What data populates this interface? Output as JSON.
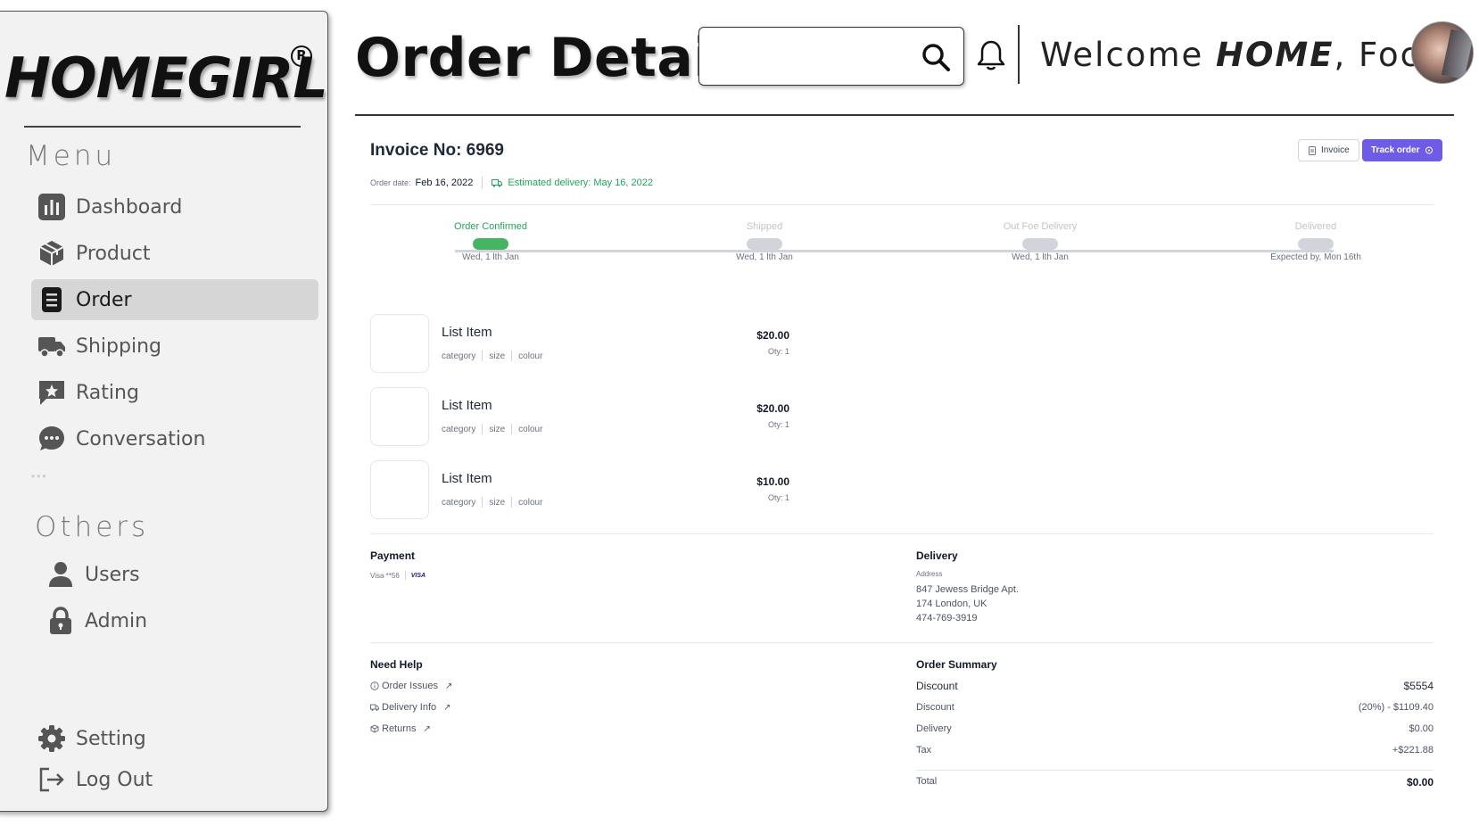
{
  "brand": {
    "logo": "HOMEGIRL",
    "reg_mark": "R"
  },
  "sidebar": {
    "menu_title": "Menu",
    "menu_items": [
      {
        "label": "Dashboard",
        "icon": "bar-chart-icon"
      },
      {
        "label": "Product",
        "icon": "box-icon"
      },
      {
        "label": "Order",
        "icon": "document-icon",
        "active": true
      },
      {
        "label": "Shipping",
        "icon": "truck-icon"
      },
      {
        "label": "Rating",
        "icon": "star-bubble-icon"
      },
      {
        "label": "Conversation",
        "icon": "chat-bubble-icon"
      }
    ],
    "others_title": "Others",
    "others_items": [
      {
        "label": "Users",
        "icon": "user-icon"
      },
      {
        "label": "Admin",
        "icon": "lock-icon"
      }
    ],
    "bottom_items": [
      {
        "label": "Setting",
        "icon": "gear-icon"
      },
      {
        "label": "Log Out",
        "icon": "logout-icon"
      }
    ]
  },
  "header": {
    "title": "Order Detail",
    "search": {
      "value": "",
      "placeholder": ""
    },
    "welcome_prefix": "Welcome ",
    "welcome_bold": "HOME",
    "welcome_suffix": ", Focus"
  },
  "order": {
    "invoice_title": "Invoice No: 6969",
    "invoice_button": "Invoice",
    "track_button": "Track order",
    "order_date_label": "Order date:",
    "order_date": "Feb 16, 2022",
    "estimated_delivery": "Estimated delivery: May 16, 2022",
    "accent_color": "#6c5ce7",
    "success_color": "#22a55a",
    "steps": [
      {
        "label": "Order Confirmed",
        "date": "Wed, 1 lth Jan",
        "done": true
      },
      {
        "label": "Shipped",
        "date": "Wed, 1 lth Jan",
        "done": false
      },
      {
        "label": "Out Foe Delivery",
        "date": "Wed, 1 lth Jan",
        "done": false
      },
      {
        "label": "Delivered",
        "date": "Expected by, Mon 16th",
        "done": false
      }
    ],
    "items": [
      {
        "name": "List Item",
        "category": "category",
        "size": "size",
        "colour": "colour",
        "price": "$20.00",
        "qty": "Oty: 1"
      },
      {
        "name": "List Item",
        "category": "category",
        "size": "size",
        "colour": "colour",
        "price": "$20.00",
        "qty": "Oty: 1"
      },
      {
        "name": "List Item",
        "category": "category",
        "size": "size",
        "colour": "colour",
        "price": "$10.00",
        "qty": "Oty: 1"
      }
    ]
  },
  "payment": {
    "title": "Payment",
    "card": "Visa **56",
    "brand": "VISA"
  },
  "delivery": {
    "title": "Delivery",
    "address_label": "Address",
    "line1": "847 Jewess Bridge Apt.",
    "line2": "174 London, UK",
    "phone": "474-769-3919"
  },
  "help": {
    "title": "Need Help",
    "links": [
      {
        "label": "Order Issues",
        "icon": "info-circle-icon"
      },
      {
        "label": "Delivery Info",
        "icon": "truck-small-icon"
      },
      {
        "label": "Returns",
        "icon": "return-icon"
      }
    ]
  },
  "summary": {
    "title": "Order Summary",
    "rows": [
      {
        "label": "Discount",
        "value": "$5554"
      },
      {
        "label": "Discount",
        "value": "(20%) - $1109.40"
      },
      {
        "label": "Delivery",
        "value": "$0.00"
      },
      {
        "label": "Tax",
        "value": "+$221.88"
      }
    ],
    "total_label": "Total",
    "total_value": "$0.00"
  }
}
